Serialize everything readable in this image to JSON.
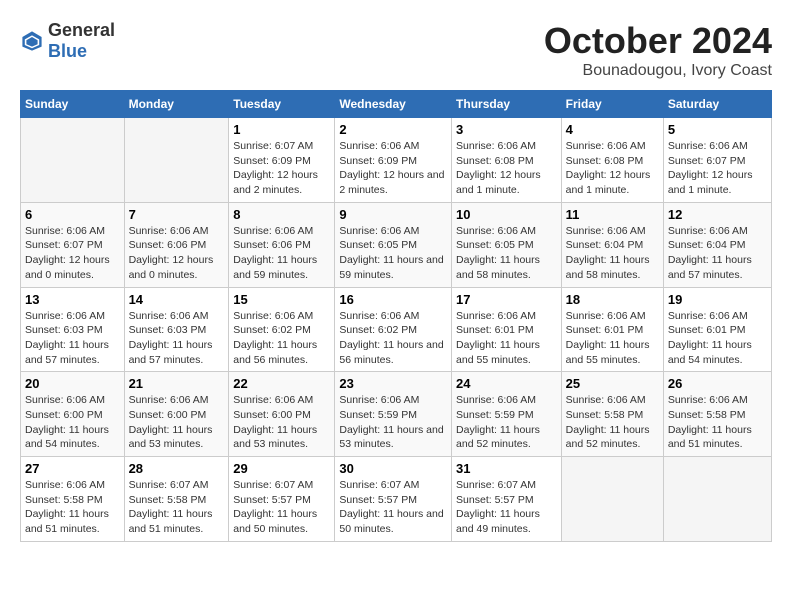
{
  "logo": {
    "general": "General",
    "blue": "Blue"
  },
  "title": "October 2024",
  "subtitle": "Bounadougou, Ivory Coast",
  "days_header": [
    "Sunday",
    "Monday",
    "Tuesday",
    "Wednesday",
    "Thursday",
    "Friday",
    "Saturday"
  ],
  "weeks": [
    [
      {
        "day": "",
        "empty": true
      },
      {
        "day": "",
        "empty": true
      },
      {
        "day": "1",
        "sunrise": "Sunrise: 6:07 AM",
        "sunset": "Sunset: 6:09 PM",
        "daylight": "Daylight: 12 hours and 2 minutes."
      },
      {
        "day": "2",
        "sunrise": "Sunrise: 6:06 AM",
        "sunset": "Sunset: 6:09 PM",
        "daylight": "Daylight: 12 hours and 2 minutes."
      },
      {
        "day": "3",
        "sunrise": "Sunrise: 6:06 AM",
        "sunset": "Sunset: 6:08 PM",
        "daylight": "Daylight: 12 hours and 1 minute."
      },
      {
        "day": "4",
        "sunrise": "Sunrise: 6:06 AM",
        "sunset": "Sunset: 6:08 PM",
        "daylight": "Daylight: 12 hours and 1 minute."
      },
      {
        "day": "5",
        "sunrise": "Sunrise: 6:06 AM",
        "sunset": "Sunset: 6:07 PM",
        "daylight": "Daylight: 12 hours and 1 minute."
      }
    ],
    [
      {
        "day": "6",
        "sunrise": "Sunrise: 6:06 AM",
        "sunset": "Sunset: 6:07 PM",
        "daylight": "Daylight: 12 hours and 0 minutes."
      },
      {
        "day": "7",
        "sunrise": "Sunrise: 6:06 AM",
        "sunset": "Sunset: 6:06 PM",
        "daylight": "Daylight: 12 hours and 0 minutes."
      },
      {
        "day": "8",
        "sunrise": "Sunrise: 6:06 AM",
        "sunset": "Sunset: 6:06 PM",
        "daylight": "Daylight: 11 hours and 59 minutes."
      },
      {
        "day": "9",
        "sunrise": "Sunrise: 6:06 AM",
        "sunset": "Sunset: 6:05 PM",
        "daylight": "Daylight: 11 hours and 59 minutes."
      },
      {
        "day": "10",
        "sunrise": "Sunrise: 6:06 AM",
        "sunset": "Sunset: 6:05 PM",
        "daylight": "Daylight: 11 hours and 58 minutes."
      },
      {
        "day": "11",
        "sunrise": "Sunrise: 6:06 AM",
        "sunset": "Sunset: 6:04 PM",
        "daylight": "Daylight: 11 hours and 58 minutes."
      },
      {
        "day": "12",
        "sunrise": "Sunrise: 6:06 AM",
        "sunset": "Sunset: 6:04 PM",
        "daylight": "Daylight: 11 hours and 57 minutes."
      }
    ],
    [
      {
        "day": "13",
        "sunrise": "Sunrise: 6:06 AM",
        "sunset": "Sunset: 6:03 PM",
        "daylight": "Daylight: 11 hours and 57 minutes."
      },
      {
        "day": "14",
        "sunrise": "Sunrise: 6:06 AM",
        "sunset": "Sunset: 6:03 PM",
        "daylight": "Daylight: 11 hours and 57 minutes."
      },
      {
        "day": "15",
        "sunrise": "Sunrise: 6:06 AM",
        "sunset": "Sunset: 6:02 PM",
        "daylight": "Daylight: 11 hours and 56 minutes."
      },
      {
        "day": "16",
        "sunrise": "Sunrise: 6:06 AM",
        "sunset": "Sunset: 6:02 PM",
        "daylight": "Daylight: 11 hours and 56 minutes."
      },
      {
        "day": "17",
        "sunrise": "Sunrise: 6:06 AM",
        "sunset": "Sunset: 6:01 PM",
        "daylight": "Daylight: 11 hours and 55 minutes."
      },
      {
        "day": "18",
        "sunrise": "Sunrise: 6:06 AM",
        "sunset": "Sunset: 6:01 PM",
        "daylight": "Daylight: 11 hours and 55 minutes."
      },
      {
        "day": "19",
        "sunrise": "Sunrise: 6:06 AM",
        "sunset": "Sunset: 6:01 PM",
        "daylight": "Daylight: 11 hours and 54 minutes."
      }
    ],
    [
      {
        "day": "20",
        "sunrise": "Sunrise: 6:06 AM",
        "sunset": "Sunset: 6:00 PM",
        "daylight": "Daylight: 11 hours and 54 minutes."
      },
      {
        "day": "21",
        "sunrise": "Sunrise: 6:06 AM",
        "sunset": "Sunset: 6:00 PM",
        "daylight": "Daylight: 11 hours and 53 minutes."
      },
      {
        "day": "22",
        "sunrise": "Sunrise: 6:06 AM",
        "sunset": "Sunset: 6:00 PM",
        "daylight": "Daylight: 11 hours and 53 minutes."
      },
      {
        "day": "23",
        "sunrise": "Sunrise: 6:06 AM",
        "sunset": "Sunset: 5:59 PM",
        "daylight": "Daylight: 11 hours and 53 minutes."
      },
      {
        "day": "24",
        "sunrise": "Sunrise: 6:06 AM",
        "sunset": "Sunset: 5:59 PM",
        "daylight": "Daylight: 11 hours and 52 minutes."
      },
      {
        "day": "25",
        "sunrise": "Sunrise: 6:06 AM",
        "sunset": "Sunset: 5:58 PM",
        "daylight": "Daylight: 11 hours and 52 minutes."
      },
      {
        "day": "26",
        "sunrise": "Sunrise: 6:06 AM",
        "sunset": "Sunset: 5:58 PM",
        "daylight": "Daylight: 11 hours and 51 minutes."
      }
    ],
    [
      {
        "day": "27",
        "sunrise": "Sunrise: 6:06 AM",
        "sunset": "Sunset: 5:58 PM",
        "daylight": "Daylight: 11 hours and 51 minutes."
      },
      {
        "day": "28",
        "sunrise": "Sunrise: 6:07 AM",
        "sunset": "Sunset: 5:58 PM",
        "daylight": "Daylight: 11 hours and 51 minutes."
      },
      {
        "day": "29",
        "sunrise": "Sunrise: 6:07 AM",
        "sunset": "Sunset: 5:57 PM",
        "daylight": "Daylight: 11 hours and 50 minutes."
      },
      {
        "day": "30",
        "sunrise": "Sunrise: 6:07 AM",
        "sunset": "Sunset: 5:57 PM",
        "daylight": "Daylight: 11 hours and 50 minutes."
      },
      {
        "day": "31",
        "sunrise": "Sunrise: 6:07 AM",
        "sunset": "Sunset: 5:57 PM",
        "daylight": "Daylight: 11 hours and 49 minutes."
      },
      {
        "day": "",
        "empty": true
      },
      {
        "day": "",
        "empty": true
      }
    ]
  ]
}
